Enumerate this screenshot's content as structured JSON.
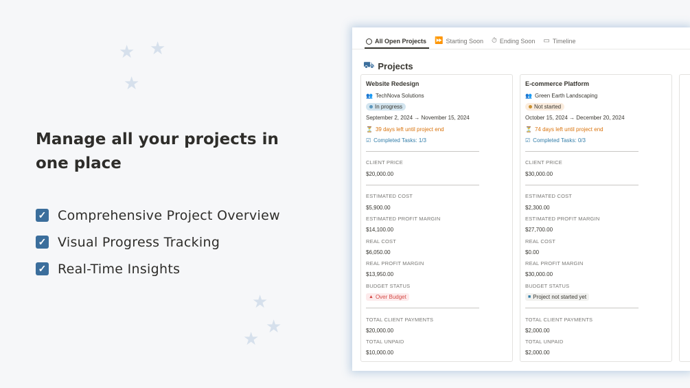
{
  "headline": "Manage all your projects in one place",
  "features": [
    "Comprehensive Project Overview",
    "Visual Progress Tracking",
    "Real-Time Insights"
  ],
  "tabs": [
    {
      "label": "All Open Projects",
      "icon": "circle-icon",
      "active": true
    },
    {
      "label": "Starting Soon",
      "icon": "fast-forward-icon",
      "active": false
    },
    {
      "label": "Ending Soon",
      "icon": "stopwatch-icon",
      "active": false
    },
    {
      "label": "Timeline",
      "icon": "timeline-icon",
      "active": false
    }
  ],
  "database": {
    "title": "Projects",
    "icon": "projects-icon"
  },
  "labels": {
    "client_price": "CLIENT PRICE",
    "estimated_cost": "ESTIMATED COST",
    "estimated_profit_margin": "ESTIMATED PROFIT MARGIN",
    "real_cost": "REAL COST",
    "real_profit_margin": "REAL PROFIT MARGIN",
    "budget_status": "BUDGET STATUS",
    "total_client_payments": "TOTAL CLIENT PAYMENTS",
    "total_unpaid": "TOTAL UNPAID"
  },
  "projects": [
    {
      "name": "Website Redesign",
      "client": "TechNova Solutions",
      "status": "In progress",
      "status_bg": "#d3e5ef",
      "status_dot": "#5b97bd",
      "dates": "September 2, 2024 → November 15, 2024",
      "days_left": "39 days left until project end",
      "tasks": "Completed Tasks: 1/3",
      "client_price": "$20,000.00",
      "estimated_cost": "$5,900.00",
      "estimated_profit_margin": "$14,100.00",
      "real_cost": "$6,050.00",
      "real_profit_margin": "$13,950.00",
      "budget_status": "Over Budget",
      "budget_icon": "▲",
      "budget_bg": "#fdebec",
      "budget_color": "#d44c47",
      "total_client_payments": "$20,000.00",
      "total_unpaid": "$10,000.00"
    },
    {
      "name": "E-commerce Platform",
      "client": "Green Earth Landscaping",
      "status": "Not started",
      "status_bg": "#fbecdd",
      "status_dot": "#cb912f",
      "dates": "October 15, 2024 → December 20, 2024",
      "days_left": "74 days left until project end",
      "tasks": "Completed Tasks: 0/3",
      "client_price": "$30,000.00",
      "estimated_cost": "$2,300.00",
      "estimated_profit_margin": "$27,700.00",
      "real_cost": "$0.00",
      "real_profit_margin": "$30,000.00",
      "budget_status": "Project not started yet",
      "budget_icon": "■",
      "budget_bg": "#f1f1ef",
      "budget_color": "#37352f",
      "total_client_payments": "$2,000.00",
      "total_unpaid": "$2,000.00"
    }
  ],
  "colors": {
    "accent": "#3b6e9c",
    "orange": "#d9730d",
    "blue": "#337ea9"
  }
}
